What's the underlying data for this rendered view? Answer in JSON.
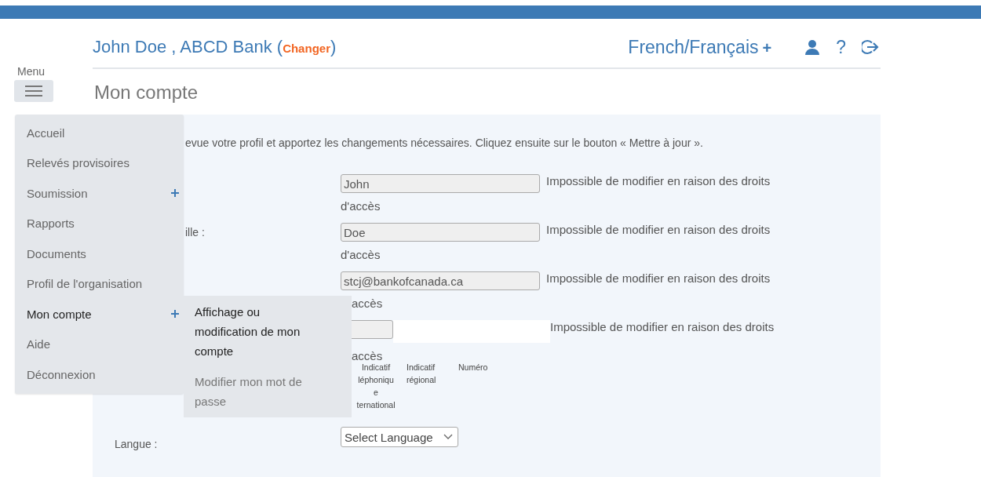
{
  "header": {
    "user": "John Doe , ABCD Bank (",
    "change_link": "Changer",
    "user_end": ")",
    "language": "French/Français",
    "language_expander": "+",
    "help": "?"
  },
  "menu": {
    "label": "Menu",
    "open": true,
    "items": [
      {
        "label": "Accueil",
        "has_submenu": false,
        "selected": false
      },
      {
        "label": "Relevés provisoires",
        "has_submenu": false,
        "selected": false
      },
      {
        "label": "Soumission",
        "has_submenu": true,
        "selected": false
      },
      {
        "label": "Rapports",
        "has_submenu": false,
        "selected": false
      },
      {
        "label": "Documents",
        "has_submenu": false,
        "selected": false
      },
      {
        "label": "Profil de l'organisation",
        "has_submenu": false,
        "selected": false
      },
      {
        "label": "Mon compte",
        "has_submenu": true,
        "selected": true,
        "children": [
          {
            "label": "Affichage ou modification de mon compte",
            "selected": true
          },
          {
            "label": "Modifier mon mot de passe",
            "selected": false
          }
        ]
      },
      {
        "label": "Aide",
        "has_submenu": false,
        "selected": false
      },
      {
        "label": "Déconnexion",
        "has_submenu": false,
        "selected": false
      }
    ]
  },
  "page": {
    "title": "Mon compte",
    "intro": "evue votre profil et apportez les changements nécessaires. Cliquez ensuite sur le bouton « Mettre à jour ».",
    "fields": [
      {
        "value": "John",
        "disabled": true,
        "note": "Impossible de modifier en raison des droits",
        "note_end": "d'accès"
      },
      {
        "label": "ille :",
        "value": "Doe",
        "disabled": true,
        "note": "Impossible de modifier en raison des droits",
        "note_end": "d'accès"
      },
      {
        "value": "stcj@bankofcanada.ca",
        "disabled": true,
        "note": "Impossible de modifier en raison des droits",
        "note_end": "accès"
      },
      {
        "kind": "phone",
        "disabled": true,
        "note": "Impossible de modifier en raison des droits",
        "note_end": "accès"
      }
    ],
    "phone_labels": [
      "Indicatif\nléphoniqu\ne\nternational",
      "Indicatif\nrégional",
      "Numéro"
    ],
    "language": {
      "label": "Langue :",
      "value": "Select Language"
    }
  }
}
